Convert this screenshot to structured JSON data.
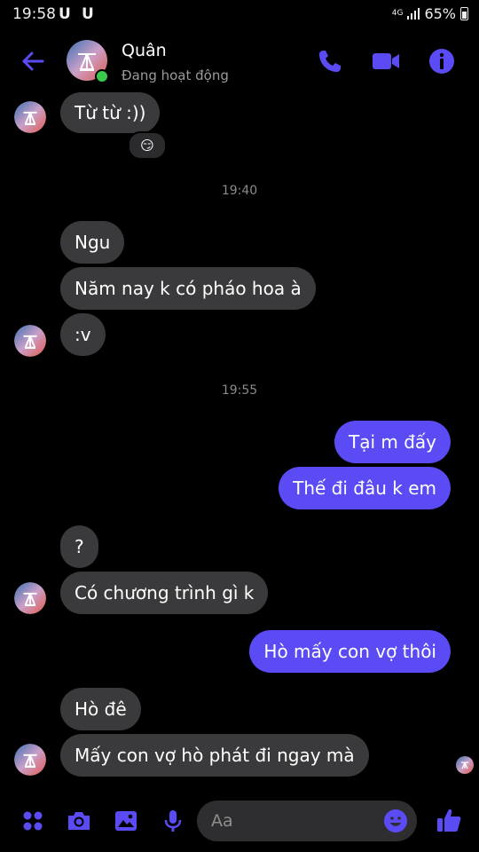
{
  "status_bar": {
    "time": "19:58",
    "notif_1": "U",
    "notif_2": "U",
    "network": "4G",
    "battery": "65%"
  },
  "header": {
    "contact_name": "Quân",
    "contact_status": "Đang hoạt động",
    "accent_color": "#5b4bf5",
    "online_color": "#3ac94b",
    "icons": [
      "back-arrow-icon",
      "phone-icon",
      "video-camera-icon",
      "info-icon"
    ]
  },
  "messages": {
    "m1": "Từ từ :))",
    "m1_reaction": "😏",
    "ts1": "19:40",
    "m2": "Ngu",
    "m3": "Năm nay k có pháo hoa à",
    "m4": ":v",
    "ts2": "19:55",
    "m5": "Tại m đấy",
    "m6": "Thế đi đâu k em",
    "m7": "?",
    "m8": "Có chương trình gì k",
    "m9": "Hò mấy con vợ thôi",
    "m10": "Hò đê",
    "m11": "Mấy con vợ hò phát đi ngay mà"
  },
  "composer": {
    "placeholder": "Aa",
    "icons": [
      "apps-grid-icon",
      "camera-icon",
      "gallery-icon",
      "microphone-icon",
      "emoji-icon",
      "thumbs-up-icon"
    ]
  }
}
